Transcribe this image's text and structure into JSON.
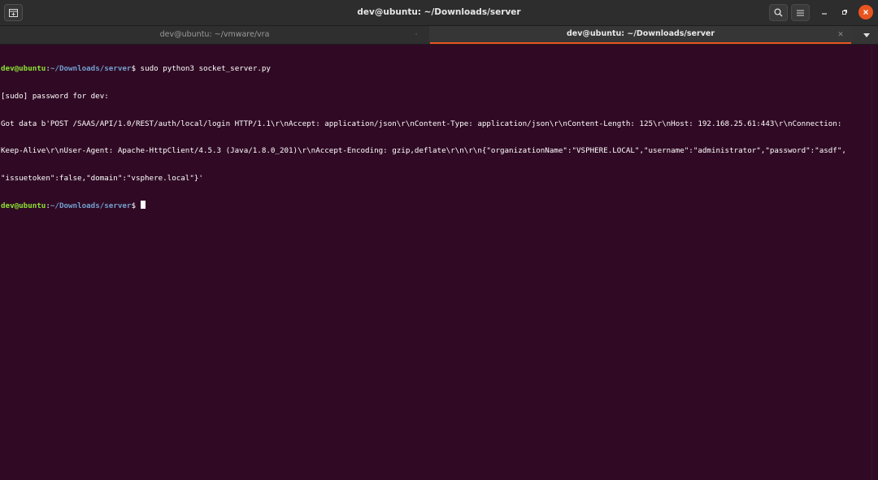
{
  "window": {
    "title": "dev@ubuntu: ~/Downloads/server"
  },
  "tabs": [
    {
      "label": "dev@ubuntu: ~/vmware/vra",
      "active": false
    },
    {
      "label": "dev@ubuntu: ~/Downloads/server",
      "active": true
    }
  ],
  "icons": {
    "new_tab": "new-tab-icon",
    "search": "search-icon",
    "menu": "hamburger-menu-icon",
    "minimize": "minimize-icon",
    "maximize": "maximize-icon",
    "close": "close-icon",
    "tab_close": "tab-close-icon",
    "tab_list": "chevron-down-icon"
  },
  "colors": {
    "terminal_bg": "#300a24",
    "prompt_user": "#8ae234",
    "prompt_path": "#729fcf",
    "accent": "#e95420"
  },
  "terminal": {
    "lines": [
      {
        "user": "dev@ubuntu",
        "sep": ":",
        "path": "~/Downloads/server",
        "symbol": "$ ",
        "cmd": "sudo python3 socket_server.py"
      },
      {
        "text": "[sudo] password for dev:"
      },
      {
        "text": "Got data b'POST /SAAS/API/1.0/REST/auth/local/login HTTP/1.1\\r\\nAccept: application/json\\r\\nContent-Type: application/json\\r\\nContent-Length: 125\\r\\nHost: 192.168.25.61:443\\r\\nConnection:"
      },
      {
        "text": "Keep-Alive\\r\\nUser-Agent: Apache-HttpClient/4.5.3 (Java/1.8.0_201)\\r\\nAccept-Encoding: gzip,deflate\\r\\n\\r\\n{\"organizationName\":\"VSPHERE.LOCAL\",\"username\":\"administrator\",\"password\":\"asdf\","
      },
      {
        "text": "\"issuetoken\":false,\"domain\":\"vsphere.local\"}'"
      },
      {
        "user": "dev@ubuntu",
        "sep": ":",
        "path": "~/Downloads/server",
        "symbol": "$ ",
        "cmd": ""
      }
    ]
  }
}
